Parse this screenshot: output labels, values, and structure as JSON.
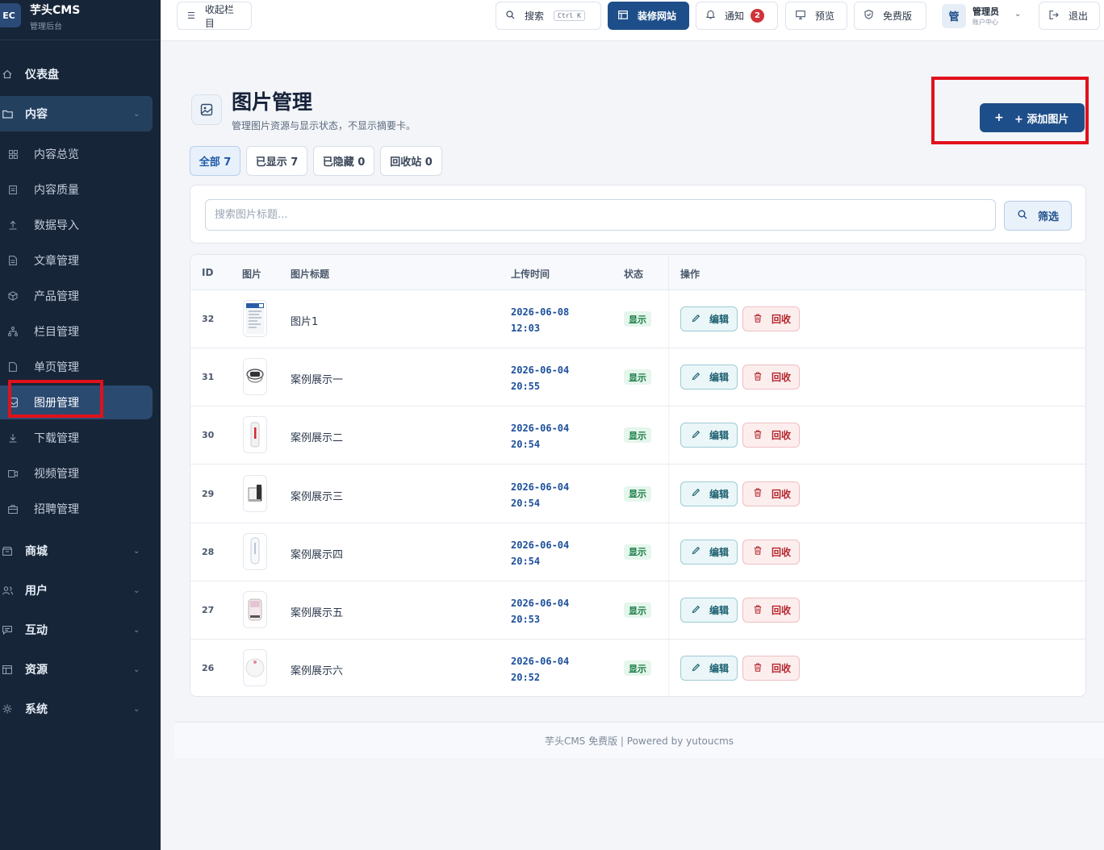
{
  "brand": {
    "logo": "EC",
    "name": "芋头CMS",
    "subtitle": "管理后台"
  },
  "sidebar": {
    "dashboard": "仪表盘",
    "content_group": "内容",
    "content_items": [
      {
        "label": "内容总览",
        "icon": "grid-icon"
      },
      {
        "label": "内容质量",
        "icon": "clipboard-icon"
      },
      {
        "label": "数据导入",
        "icon": "upload-icon"
      },
      {
        "label": "文章管理",
        "icon": "document-icon"
      },
      {
        "label": "产品管理",
        "icon": "box-icon"
      },
      {
        "label": "栏目管理",
        "icon": "tree-icon"
      },
      {
        "label": "单页管理",
        "icon": "page-icon"
      },
      {
        "label": "图册管理",
        "icon": "image-icon"
      },
      {
        "label": "下载管理",
        "icon": "download-icon"
      },
      {
        "label": "视频管理",
        "icon": "video-icon"
      },
      {
        "label": "招聘管理",
        "icon": "briefcase-icon"
      }
    ],
    "groups": [
      "商城",
      "用户",
      "互动",
      "资源",
      "系统"
    ]
  },
  "topbar": {
    "collapse": "收起栏目",
    "search": "搜索",
    "search_kbd": "Ctrl K",
    "decorate": "装修网站",
    "notify": "通知",
    "notify_count": "2",
    "preview": "预览",
    "edition": "免费版",
    "user_avatar": "管",
    "user_name": "管理员",
    "user_sub": "账户中心",
    "logout": "退出"
  },
  "page": {
    "title": "图片管理",
    "description": "管理图片资源与显示状态，不显示摘要卡。",
    "add_button": "+ 添加图片",
    "tabs": [
      "全部 7",
      "已显示 7",
      "已隐藏 0",
      "回收站 0"
    ],
    "search_placeholder": "搜索图片标题...",
    "filter_button": "筛选"
  },
  "table": {
    "headers": {
      "id": "ID",
      "image": "图片",
      "title": "图片标题",
      "time": "上传时间",
      "status": "状态",
      "actions": "操作"
    },
    "edit_label": "编辑",
    "recycle_label": "回收",
    "rows": [
      {
        "id": "32",
        "title": "图片1",
        "date": "2026-06-08",
        "time": "12:03",
        "status": "显示"
      },
      {
        "id": "31",
        "title": "案例展示一",
        "date": "2026-06-04",
        "time": "20:55",
        "status": "显示"
      },
      {
        "id": "30",
        "title": "案例展示二",
        "date": "2026-06-04",
        "time": "20:54",
        "status": "显示"
      },
      {
        "id": "29",
        "title": "案例展示三",
        "date": "2026-06-04",
        "time": "20:54",
        "status": "显示"
      },
      {
        "id": "28",
        "title": "案例展示四",
        "date": "2026-06-04",
        "time": "20:54",
        "status": "显示"
      },
      {
        "id": "27",
        "title": "案例展示五",
        "date": "2026-06-04",
        "time": "20:53",
        "status": "显示"
      },
      {
        "id": "26",
        "title": "案例展示六",
        "date": "2026-06-04",
        "time": "20:52",
        "status": "显示"
      }
    ]
  },
  "footer": "芋头CMS 免费版 | Powered by yutoucms",
  "colors": {
    "sidebar": "#172538",
    "primary": "#1d4e89",
    "highlight": "#e0111c",
    "status_green": "#157a43",
    "danger": "#b3262d"
  }
}
